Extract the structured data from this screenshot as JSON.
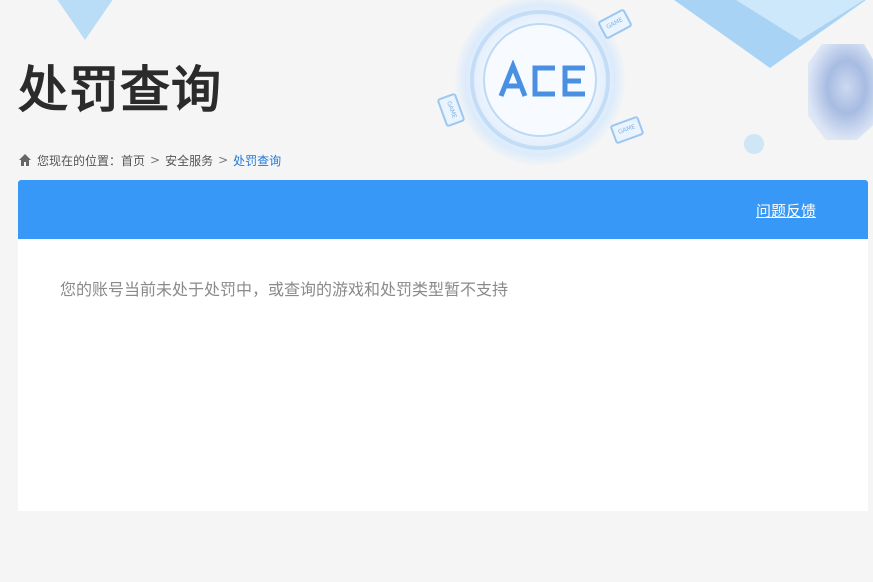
{
  "header": {
    "title": "处罚查询",
    "emblem_logo": "ACE",
    "game_card_label": "GAME"
  },
  "breadcrumb": {
    "prefix": "您现在的位置：",
    "items": [
      "首页",
      "安全服务",
      "处罚查询"
    ],
    "separator": ">"
  },
  "panel": {
    "feedback_label": "问题反馈",
    "message": "您的账号当前未处于处罚中，或查询的游戏和处罚类型暂不支持"
  },
  "colors": {
    "accent": "#3898f8",
    "active_crumb": "#1f7ad9",
    "page_bg": "#f5f5f5"
  }
}
